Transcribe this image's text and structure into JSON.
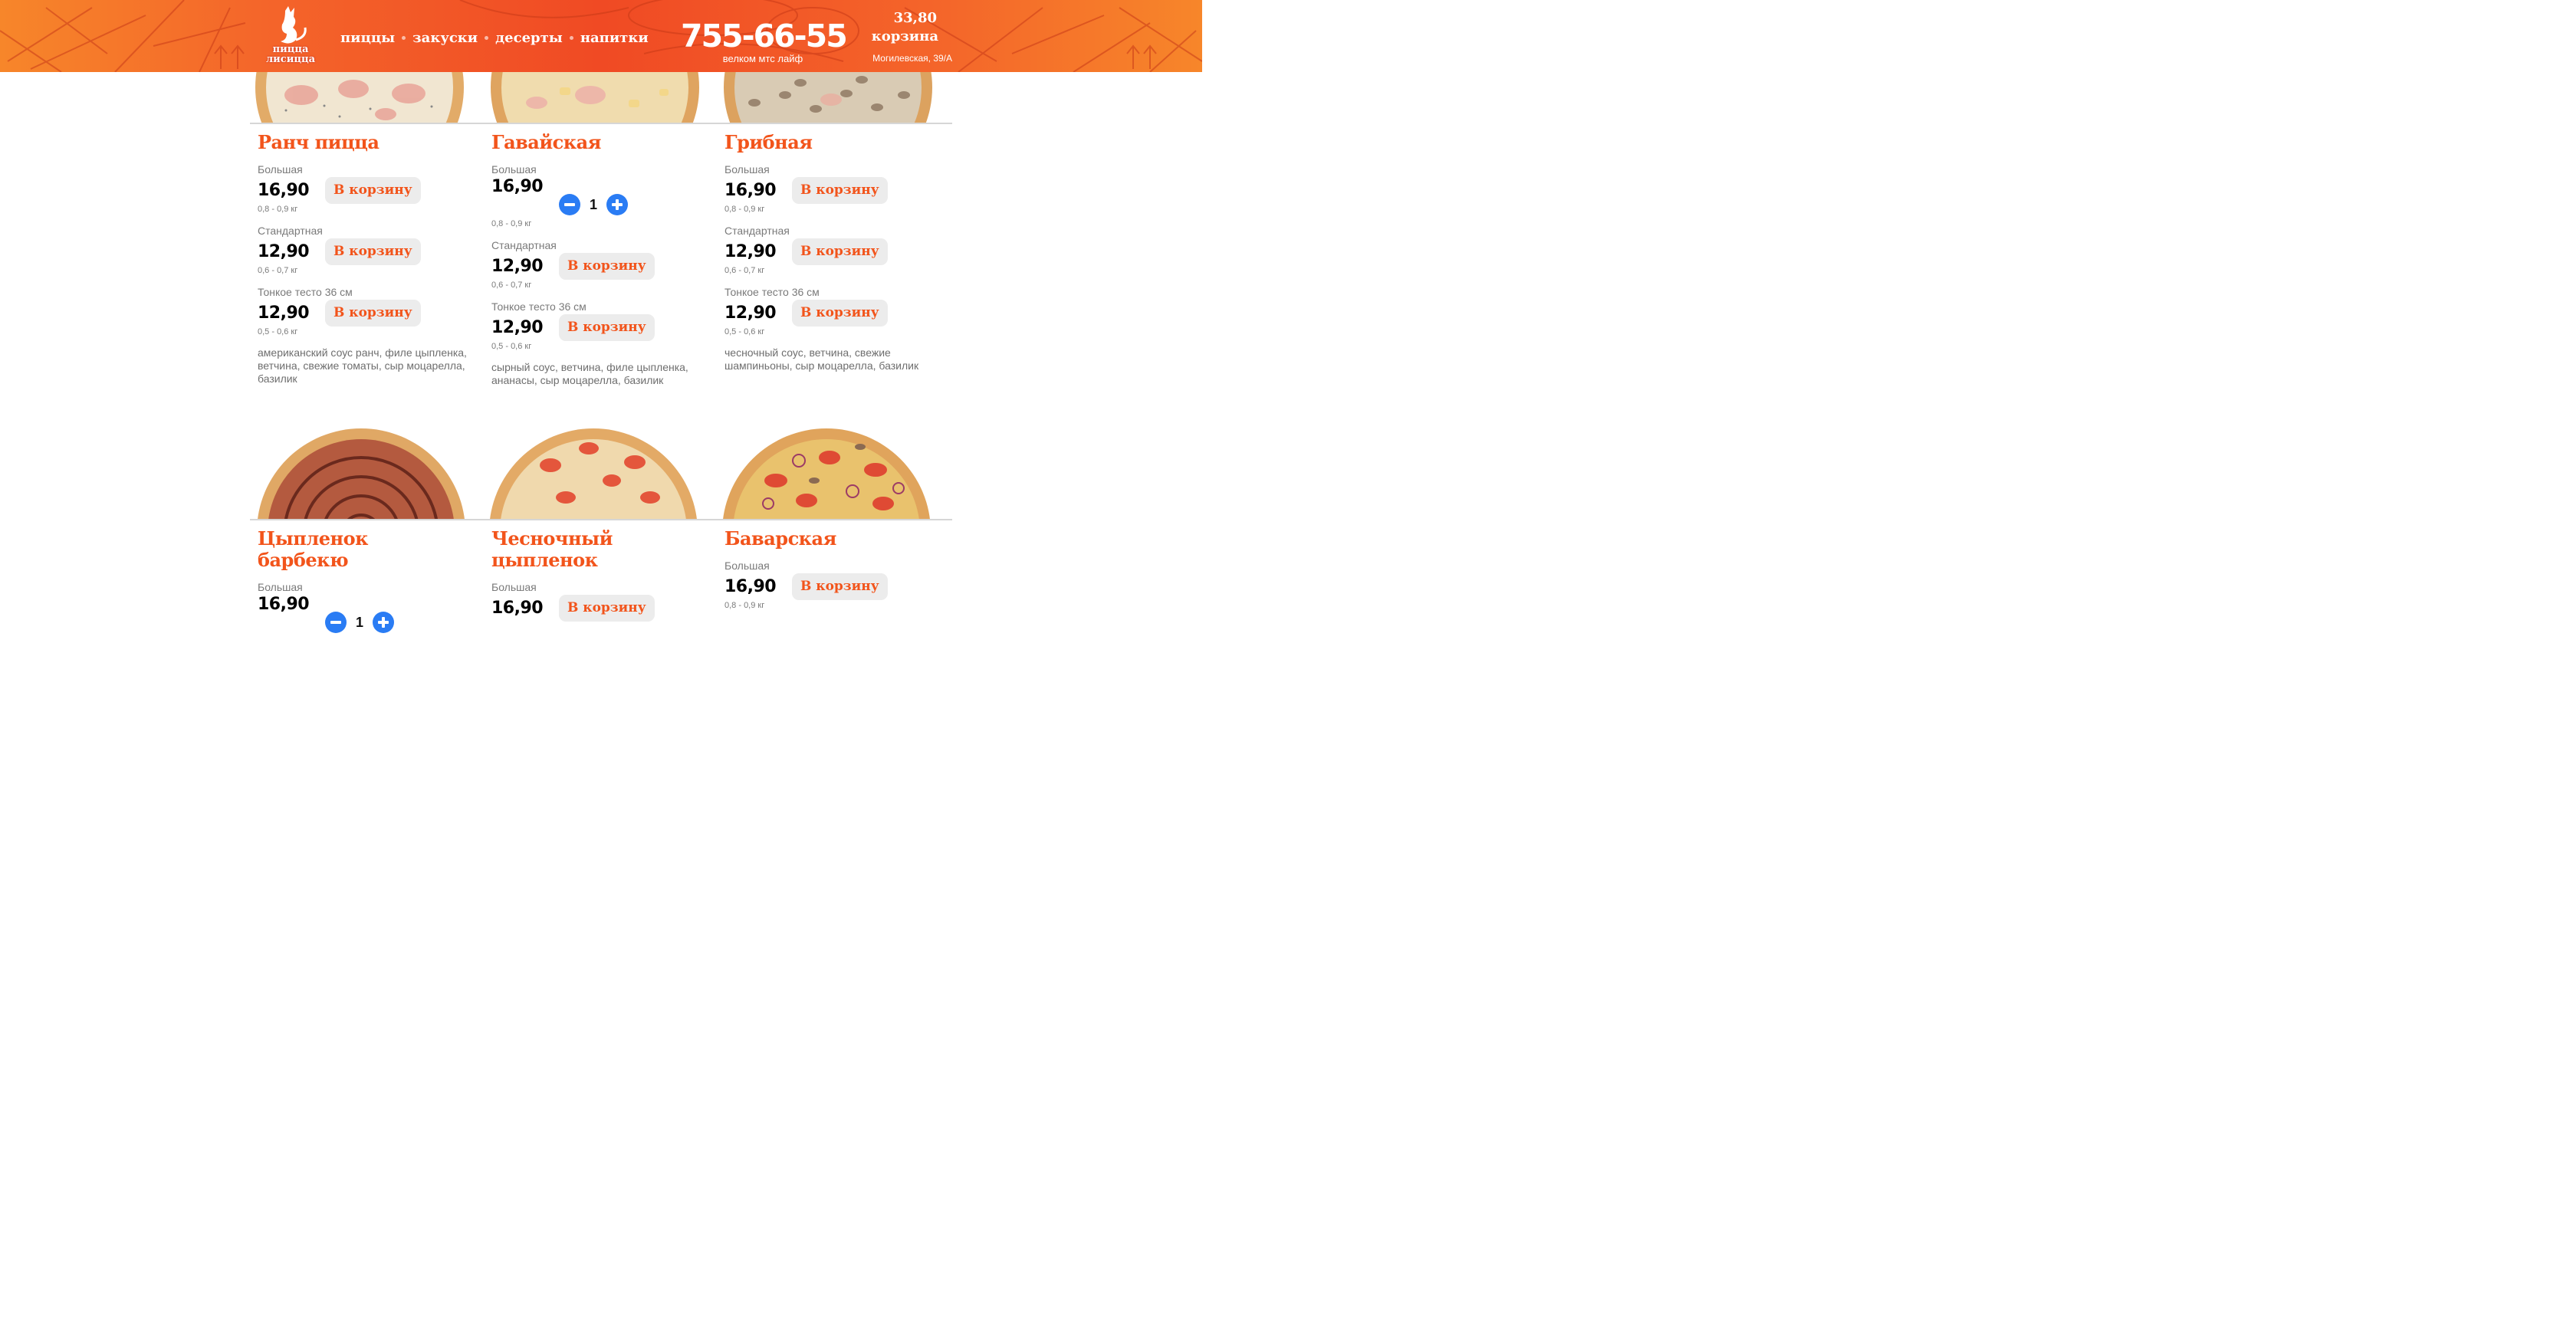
{
  "header": {
    "logo_lines": [
      "пицца",
      "лисицца"
    ],
    "nav": [
      "пиццы",
      "закуски",
      "десерты",
      "напитки"
    ],
    "phone": "755-66-55",
    "phone_sub": "велком мтс лайф",
    "cart_total": "33,80",
    "cart_label": "корзина",
    "address": "Могилевская, 39/А"
  },
  "products": [
    {
      "title": "Ранч пицца",
      "options": [
        {
          "size": "Большая",
          "price": "16,90",
          "weight": "0,8 - 0,9 кг",
          "button": "В корзину"
        },
        {
          "size": "Стандартная",
          "price": "12,90",
          "weight": "0,6 - 0,7 кг",
          "button": "В корзину"
        },
        {
          "size": "Тонкое тесто 36 см",
          "price": "12,90",
          "weight": "0,5 - 0,6 кг",
          "button": "В корзину"
        }
      ],
      "description": "американский соус ранч, филе цыпленка, ветчина, свежие томаты, сыр моцарелла, базилик"
    },
    {
      "title": "Гавайская",
      "options": [
        {
          "size": "Большая",
          "price": "16,90",
          "weight": "0,8 - 0,9 кг",
          "quantity": "1"
        },
        {
          "size": "Стандартная",
          "price": "12,90",
          "weight": "0,6 - 0,7 кг",
          "button": "В корзину"
        },
        {
          "size": "Тонкое тесто 36 см",
          "price": "12,90",
          "weight": "0,5 - 0,6 кг",
          "button": "В корзину"
        }
      ],
      "description": "сырный соус, ветчина, филе цыпленка, ананасы, сыр моцарелла, базилик"
    },
    {
      "title": "Грибная",
      "options": [
        {
          "size": "Большая",
          "price": "16,90",
          "weight": "0,8 - 0,9 кг",
          "button": "В корзину"
        },
        {
          "size": "Стандартная",
          "price": "12,90",
          "weight": "0,6 - 0,7 кг",
          "button": "В корзину"
        },
        {
          "size": "Тонкое тесто 36 см",
          "price": "12,90",
          "weight": "0,5 - 0,6 кг",
          "button": "В корзину"
        }
      ],
      "description": "чесночный соус, ветчина, свежие шампиньоны, сыр моцарелла, базилик"
    },
    {
      "title": "Цыпленок барбекю",
      "options": [
        {
          "size": "Большая",
          "price": "16,90",
          "quantity": "1"
        }
      ]
    },
    {
      "title": "Чесночный цыпленок",
      "options": [
        {
          "size": "Большая",
          "price": "16,90",
          "button": "В корзину"
        }
      ]
    },
    {
      "title": "Баварская",
      "options": [
        {
          "size": "Большая",
          "price": "16,90",
          "weight": "0,8 - 0,9 кг",
          "button": "В корзину"
        }
      ]
    }
  ],
  "colors": {
    "header_orange": "#f4652a",
    "accent": "#f2541b",
    "qty_button": "#2a7cf4",
    "button_bg": "#ececec"
  },
  "icons": [
    "fox-logo-icon",
    "minus-icon",
    "plus-icon",
    "pizza-image"
  ]
}
